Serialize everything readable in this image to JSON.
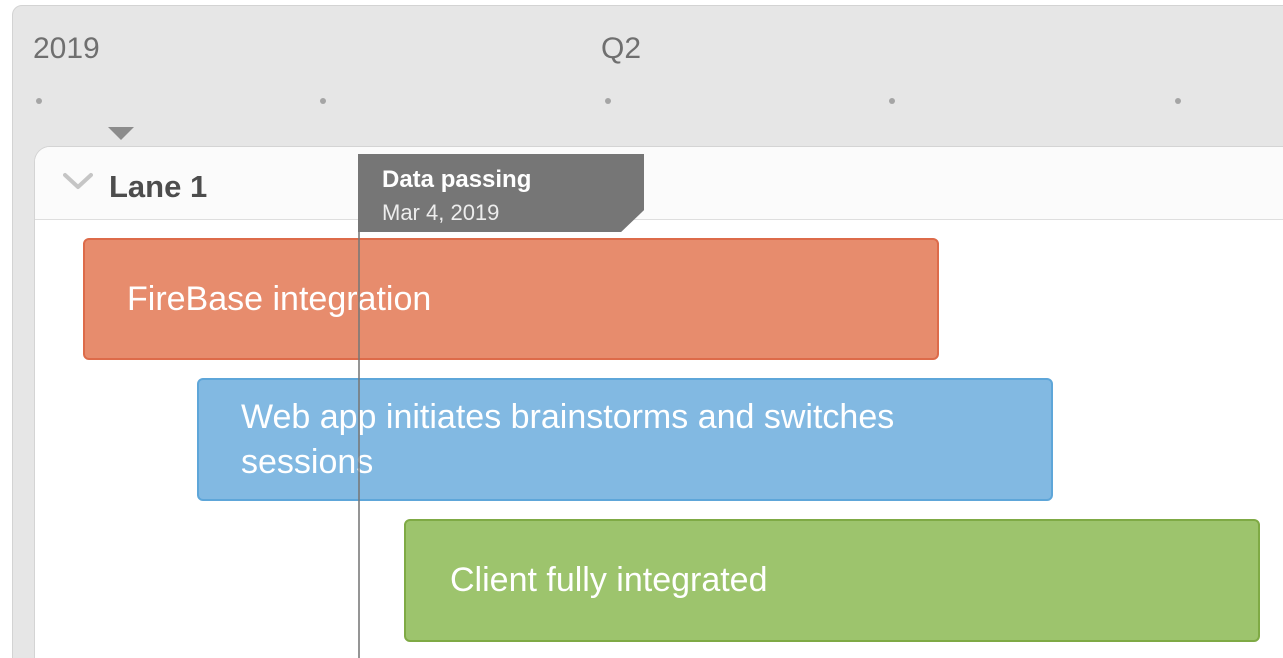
{
  "timescale": {
    "labels": [
      "2019",
      "Q2"
    ]
  },
  "lane": {
    "title": "Lane 1",
    "collapse_icon": "chevron-down-icon"
  },
  "milestone": {
    "title": "Data passing",
    "date": "Mar 4, 2019"
  },
  "bars": [
    {
      "label": "FireBase integration",
      "fill_color": "#e78c6d",
      "border_color": "#dd6b4a"
    },
    {
      "label": "Web app initiates brainstorms and switches sessions",
      "fill_color": "#82b9e2",
      "border_color": "#5ea6d9"
    },
    {
      "label": "Client fully integrated",
      "fill_color": "#9dc46d",
      "border_color": "#7faa45"
    }
  ],
  "colors": {
    "timeline_background": "#e6e6e6",
    "lane_background": "#ffffff",
    "milestone_background": "#767676"
  }
}
